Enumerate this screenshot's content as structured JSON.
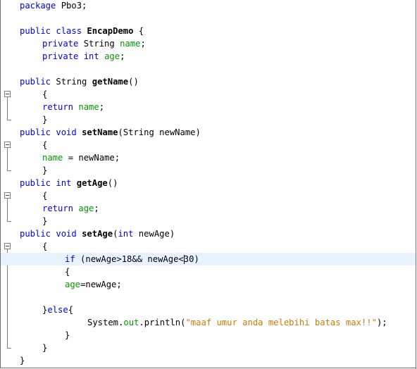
{
  "editor": {
    "lines": [
      {
        "indent": 0,
        "tokens": [
          {
            "t": "package",
            "c": "kw"
          },
          {
            "t": " Pbo3;"
          }
        ]
      },
      {
        "indent": 0,
        "tokens": []
      },
      {
        "indent": 0,
        "tokens": [
          {
            "t": "public",
            "c": "kw"
          },
          {
            "t": " "
          },
          {
            "t": "class",
            "c": "kw"
          },
          {
            "t": " "
          },
          {
            "t": "EncapDemo",
            "c": "mth"
          },
          {
            "t": " {"
          }
        ]
      },
      {
        "indent": 4,
        "tokens": [
          {
            "t": "private",
            "c": "kw"
          },
          {
            "t": " String "
          },
          {
            "t": "name",
            "c": "fld"
          },
          {
            "t": ";"
          }
        ]
      },
      {
        "indent": 4,
        "tokens": [
          {
            "t": "private",
            "c": "kw"
          },
          {
            "t": " "
          },
          {
            "t": "int",
            "c": "kw"
          },
          {
            "t": " "
          },
          {
            "t": "age",
            "c": "fld"
          },
          {
            "t": ";"
          }
        ]
      },
      {
        "indent": 0,
        "tokens": []
      },
      {
        "indent": 0,
        "tokens": [
          {
            "t": "public",
            "c": "kw"
          },
          {
            "t": " String "
          },
          {
            "t": "getName",
            "c": "mth"
          },
          {
            "t": "()"
          }
        ]
      },
      {
        "indent": 4,
        "tokens": [
          {
            "t": "{"
          }
        ]
      },
      {
        "indent": 4,
        "tokens": [
          {
            "t": "return",
            "c": "kw"
          },
          {
            "t": " "
          },
          {
            "t": "name",
            "c": "fld"
          },
          {
            "t": ";"
          }
        ]
      },
      {
        "indent": 4,
        "tokens": [
          {
            "t": "}"
          }
        ]
      },
      {
        "indent": 0,
        "tokens": [
          {
            "t": "public",
            "c": "kw"
          },
          {
            "t": " "
          },
          {
            "t": "void",
            "c": "kw"
          },
          {
            "t": " "
          },
          {
            "t": "setName",
            "c": "mth"
          },
          {
            "t": "(String newName)"
          }
        ]
      },
      {
        "indent": 4,
        "tokens": [
          {
            "t": "{"
          }
        ]
      },
      {
        "indent": 4,
        "tokens": [
          {
            "t": "name",
            "c": "fld"
          },
          {
            "t": " = newName;"
          }
        ]
      },
      {
        "indent": 4,
        "tokens": [
          {
            "t": "}"
          }
        ]
      },
      {
        "indent": 0,
        "tokens": [
          {
            "t": "public",
            "c": "kw"
          },
          {
            "t": " "
          },
          {
            "t": "int",
            "c": "kw"
          },
          {
            "t": " "
          },
          {
            "t": "getAge",
            "c": "mth"
          },
          {
            "t": "()"
          }
        ]
      },
      {
        "indent": 4,
        "tokens": [
          {
            "t": "{"
          }
        ]
      },
      {
        "indent": 4,
        "tokens": [
          {
            "t": "return",
            "c": "kw"
          },
          {
            "t": " "
          },
          {
            "t": "age",
            "c": "fld"
          },
          {
            "t": ";"
          }
        ]
      },
      {
        "indent": 4,
        "tokens": [
          {
            "t": "}"
          }
        ]
      },
      {
        "indent": 0,
        "tokens": [
          {
            "t": "public",
            "c": "kw"
          },
          {
            "t": " "
          },
          {
            "t": "void",
            "c": "kw"
          },
          {
            "t": " "
          },
          {
            "t": "setAge",
            "c": "mth"
          },
          {
            "t": "("
          },
          {
            "t": "int",
            "c": "kw"
          },
          {
            "t": " newAge)"
          }
        ]
      },
      {
        "indent": 4,
        "tokens": [
          {
            "t": "{"
          }
        ]
      },
      {
        "indent": 8,
        "highlight": true,
        "tokens": [
          {
            "t": "if",
            "c": "kw"
          },
          {
            "t": " (newAge>18&& newAge<"
          },
          {
            "t": "|",
            "c": "caret"
          },
          {
            "t": "30)"
          }
        ]
      },
      {
        "indent": 8,
        "tokens": [
          {
            "t": "{"
          }
        ]
      },
      {
        "indent": 8,
        "tokens": [
          {
            "t": "age",
            "c": "fld"
          },
          {
            "t": "=newAge;"
          }
        ]
      },
      {
        "indent": 0,
        "tokens": []
      },
      {
        "indent": 4,
        "tokens": [
          {
            "t": "}"
          },
          {
            "t": "else",
            "c": "kw"
          },
          {
            "t": "{"
          }
        ]
      },
      {
        "indent": 12,
        "tokens": [
          {
            "t": "System."
          },
          {
            "t": "out",
            "c": "fld"
          },
          {
            "t": ".println("
          },
          {
            "t": "\"maaf umur anda melebihi batas max!!\"",
            "c": "str"
          },
          {
            "t": ");"
          }
        ]
      },
      {
        "indent": 8,
        "tokens": [
          {
            "t": "}"
          }
        ]
      },
      {
        "indent": 4,
        "tokens": [
          {
            "t": "}"
          }
        ]
      },
      {
        "indent": 0,
        "tokens": [
          {
            "t": "}"
          }
        ]
      }
    ]
  }
}
